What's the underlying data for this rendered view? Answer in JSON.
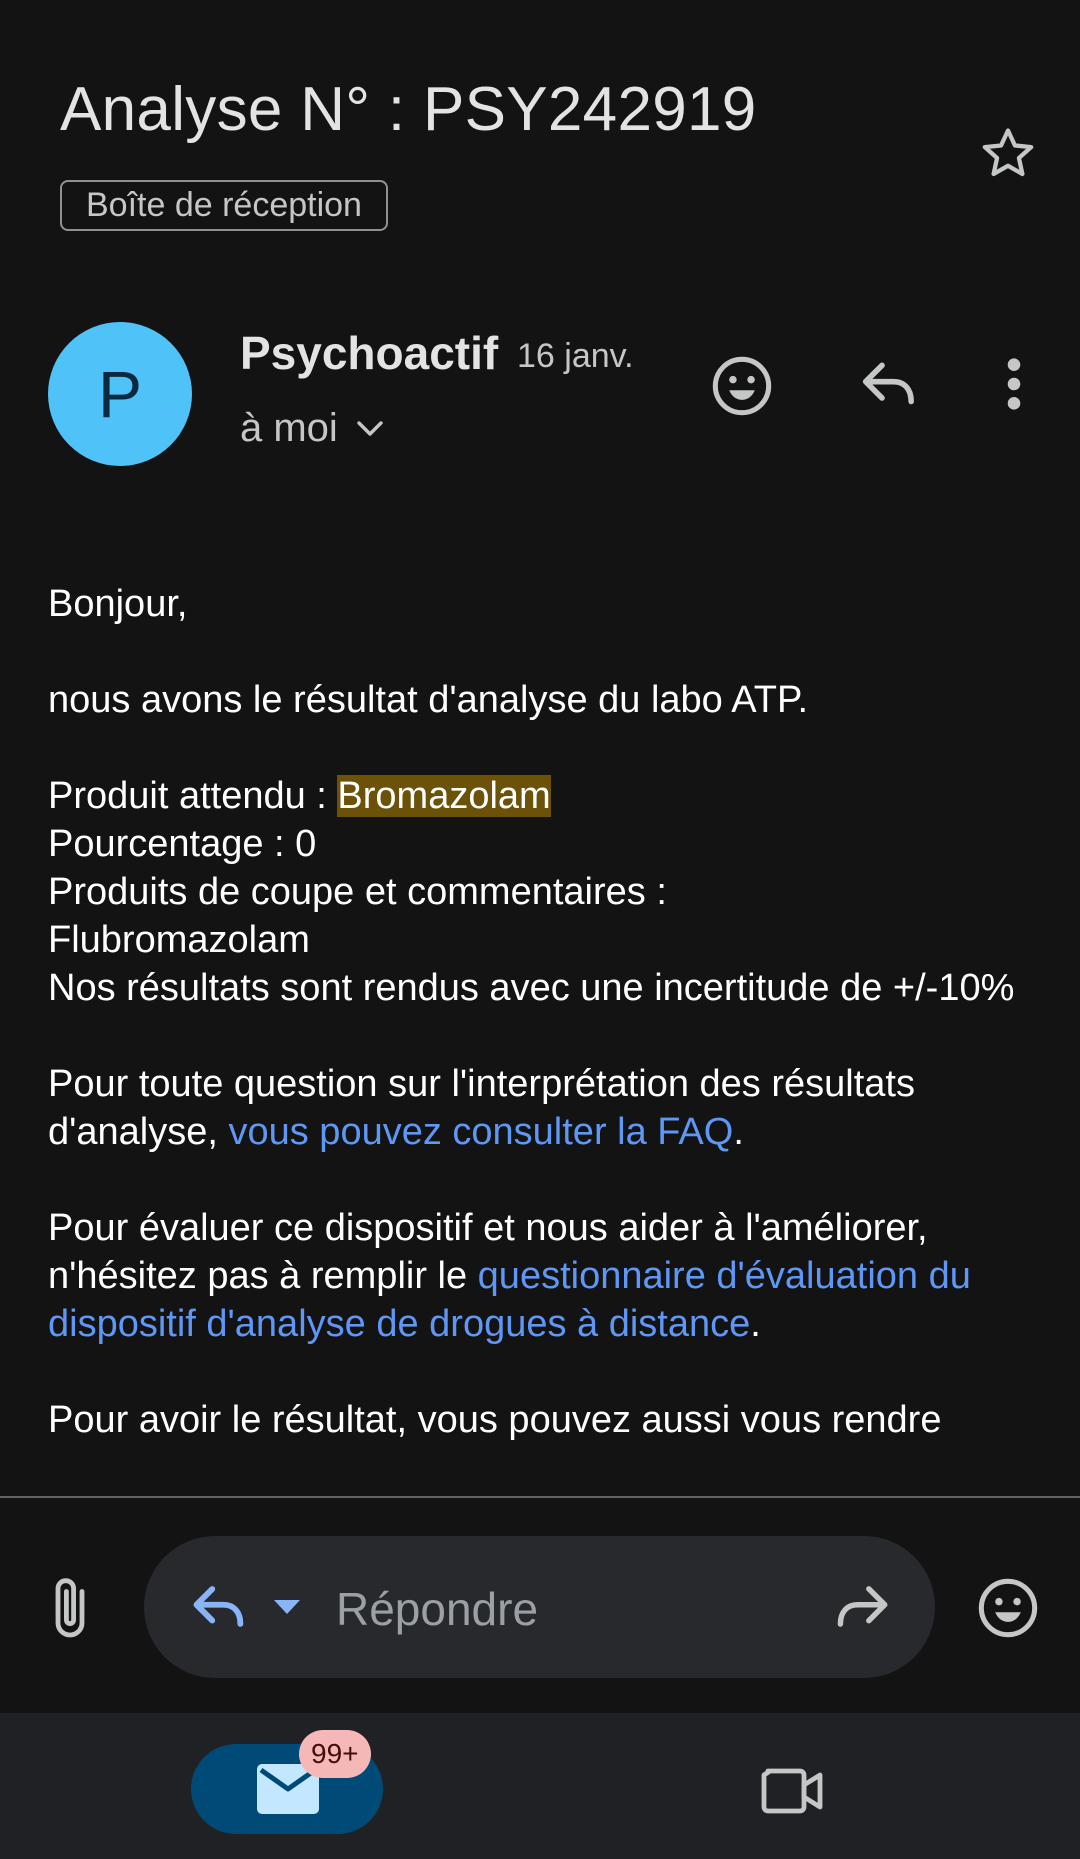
{
  "email": {
    "subject": "Analyse N° : PSY242919",
    "label": "Boîte de réception",
    "sender": {
      "initial": "P",
      "name": "Psychoactif",
      "date": "16 janv.",
      "recipient": "à moi"
    },
    "body": {
      "greeting": "Bonjour,",
      "intro": "nous avons le résultat d'analyse du labo ATP.",
      "expected_prefix": "Produit attendu : ",
      "expected_product": "Bromazolam",
      "percentage": "Pourcentage : 0",
      "cutting_agents_label": "Produits de coupe et commentaires :",
      "cutting_agents_value": "Flubromazolam",
      "uncertainty": "Nos résultats sont rendus avec une incertitude de +/-10%",
      "faq_text": "Pour toute question sur l'interprétation des résultats d'analyse, ",
      "faq_link": "vous pouvez consulter la FAQ",
      "faq_end": ".",
      "survey_text": "Pour évaluer ce dispositif et nous aider à l'améliorer, n'hésitez pas à remplir le ",
      "survey_link": "questionnaire d'évaluation du dispositif d'analyse de drogues à distance",
      "survey_end": ".",
      "more": "Pour avoir le résultat, vous pouvez aussi vous rendre"
    }
  },
  "reply_bar": {
    "placeholder": "Répondre"
  },
  "bottom_nav": {
    "mail_badge": "99+"
  },
  "icons": {
    "star": "star-outline-icon",
    "emoji": "emoji-icon",
    "reply": "reply-icon",
    "more": "more-vert-icon",
    "attach": "paperclip-icon",
    "forward": "forward-icon",
    "mail": "mail-icon",
    "video": "video-icon"
  },
  "colors": {
    "background": "#131314",
    "avatar": "#4fc3f7",
    "link": "#5e97f6",
    "highlight": "#6b5208",
    "mail_pill": "#004a77",
    "badge": "#f6b8b6"
  }
}
